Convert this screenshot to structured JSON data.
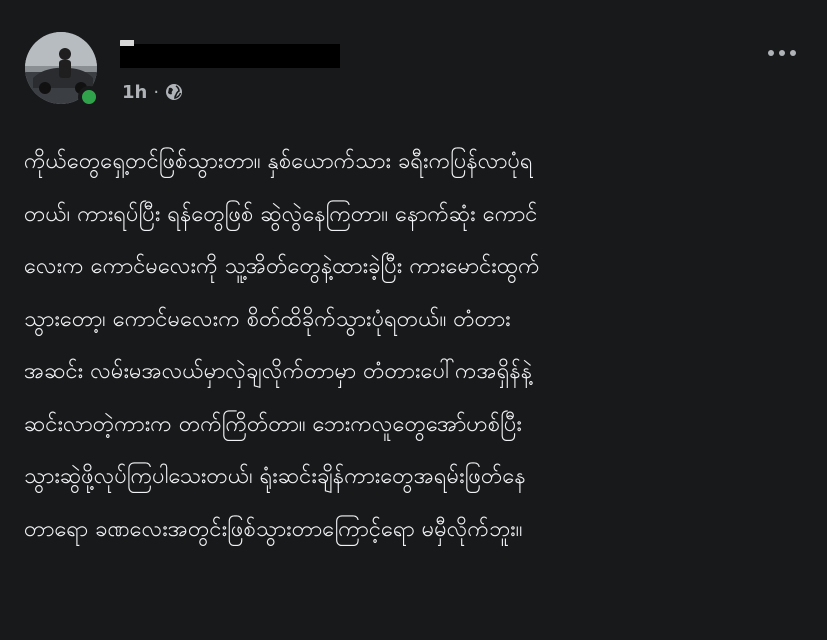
{
  "post": {
    "timestamp": "1h",
    "separator": "·",
    "privacy_icon": "globe-icon",
    "more_icon": "more-horizontal-icon",
    "body_lines": [
      "ကိုယ်တွေရှေ့တင်ဖြစ်သွားတာ။ နှစ်ယောက်သား ခရီးကပြန်လာပုံရ",
      "တယ်၊ ကားရပ်ပြီး ရန်တွေဖြစ် ဆွဲလွဲနေကြတာ။ နောက်ဆုံး ကောင်",
      "လေးက ကောင်မလေးကို သူ့အိတ်တွေနဲ့ထားခဲ့ပြီး ကားမောင်းထွက်",
      "သွားတော့၊ ကောင်မလေးက စိတ်ထိခိုက်သွားပုံရတယ်။ တံတား",
      "အဆင်း လမ်းမအလယ်မှာလှဲချလိုက်တာမှာ တံတားပေါ်ကအရှိန်နဲ့",
      "ဆင်းလာတဲ့ကားက တက်ကြိတ်တာ။ ဘေးကလူတွေအော်ဟစ်ပြီး",
      "သွားဆွဲဖို့လုပ်ကြပါသေးတယ်၊ ရုံးဆင်းချိန်ကားတွေအရမ်းဖြတ်နေ",
      "တာရော ခဏလေးအတွင်းဖြစ်သွားတာကြောင့်ရော မမှီလိုက်ဘူး။"
    ]
  },
  "colors": {
    "background": "#18191a",
    "text": "#e4e6eb",
    "secondary_text": "#b0b3b8",
    "online": "#31a24c"
  }
}
